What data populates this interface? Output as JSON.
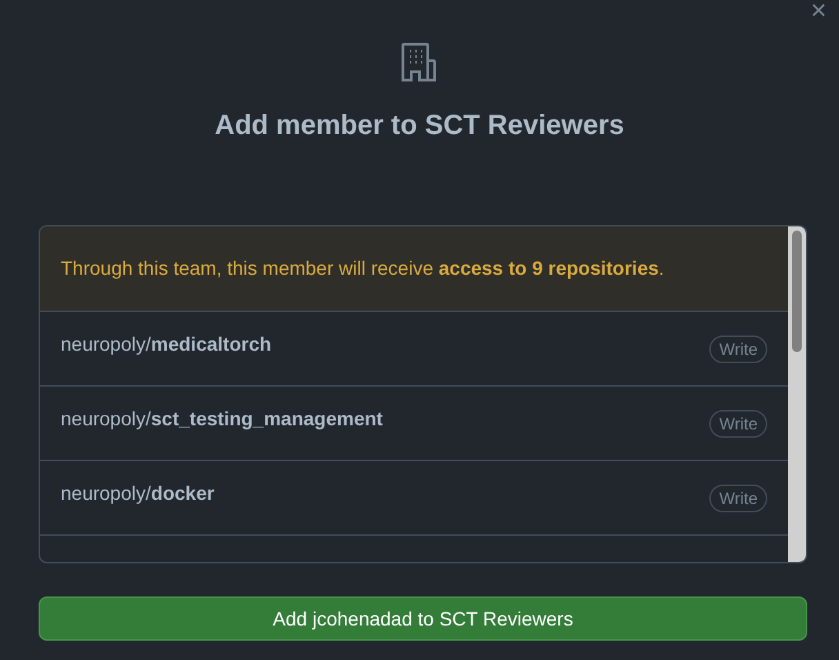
{
  "dialog": {
    "close": "×",
    "title": "Add member to SCT Reviewers"
  },
  "notice": "Through this team, this member will receive **access to 9 repositories**.",
  "repositories": [
    {
      "owner": "neuropoly/",
      "name": "medicaltorch",
      "permission": "Write"
    },
    {
      "owner": "neuropoly/",
      "name": "sct_testing_management",
      "permission": "Write"
    },
    {
      "owner": "neuropoly/",
      "name": "docker",
      "permission": "Write"
    }
  ],
  "submit_button": "Add jcohenadad to SCT Reviewers"
}
